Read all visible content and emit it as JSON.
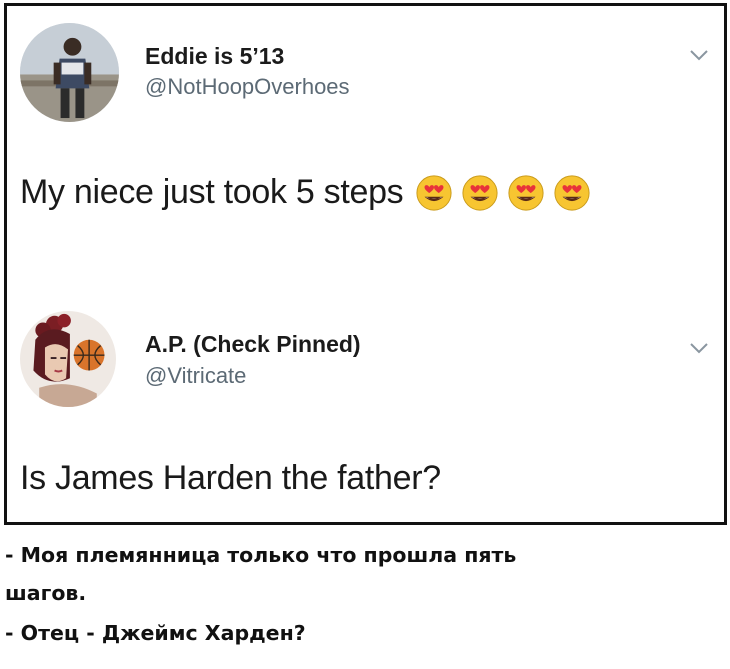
{
  "tweets": [
    {
      "display_name": "Eddie is 5’13",
      "handle": "@NotHoopOverhoes",
      "text": "My niece just took 5 steps",
      "emoji": [
        "heart-eyes",
        "heart-eyes",
        "heart-eyes",
        "heart-eyes"
      ],
      "menu_icon": "chevron-down-icon"
    },
    {
      "display_name": "A.P. (Check Pinned)",
      "handle": "@Vitricate",
      "text": "Is James Harden the father?",
      "menu_icon": "chevron-down-icon"
    }
  ],
  "caption": {
    "line_1": "- Моя племянница только что прошла пять",
    "line_2": "шагов.",
    "line_3": "- Отец - Джеймс Харден?"
  },
  "colors": {
    "name": "#1b1b1b",
    "handle": "#5c6a75",
    "border": "#111111",
    "emoji_face": "#f7c531",
    "emoji_heart": "#e8323a"
  }
}
